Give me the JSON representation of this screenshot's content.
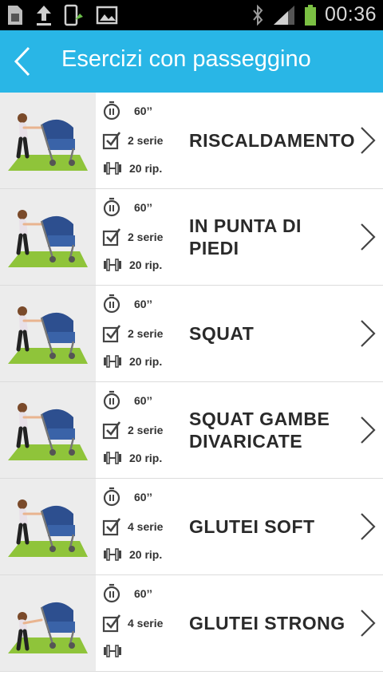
{
  "status_bar": {
    "time": "00:36",
    "left_icons": [
      "sim-card-icon",
      "upload-icon",
      "phone-sync-icon",
      "image-icon"
    ],
    "right_icons": [
      "bluetooth-icon",
      "signal-icon",
      "battery-icon"
    ]
  },
  "header": {
    "title": "Esercizi con passeggino"
  },
  "exercises": [
    {
      "name": "RISCALDAMENTO",
      "duration": "60’’",
      "series": "2 serie",
      "reps": "20 rip."
    },
    {
      "name": "IN PUNTA DI PIEDI",
      "duration": "60’’",
      "series": "2 serie",
      "reps": "20 rip."
    },
    {
      "name": "SQUAT",
      "duration": "60’’",
      "series": "2 serie",
      "reps": "20 rip."
    },
    {
      "name": "SQUAT GAMBE DIVARICATE",
      "duration": "60’’",
      "series": "2 serie",
      "reps": "20 rip."
    },
    {
      "name": "GLUTEI SOFT",
      "duration": "60’’",
      "series": "4 serie",
      "reps": "20 rip."
    },
    {
      "name": "GLUTEI STRONG",
      "duration": "60’’",
      "series": "4 serie",
      "reps": ""
    }
  ],
  "colors": {
    "appbar": "#29b6e6",
    "mat": "#8fc43a",
    "stroller": "#2d4f8f"
  }
}
